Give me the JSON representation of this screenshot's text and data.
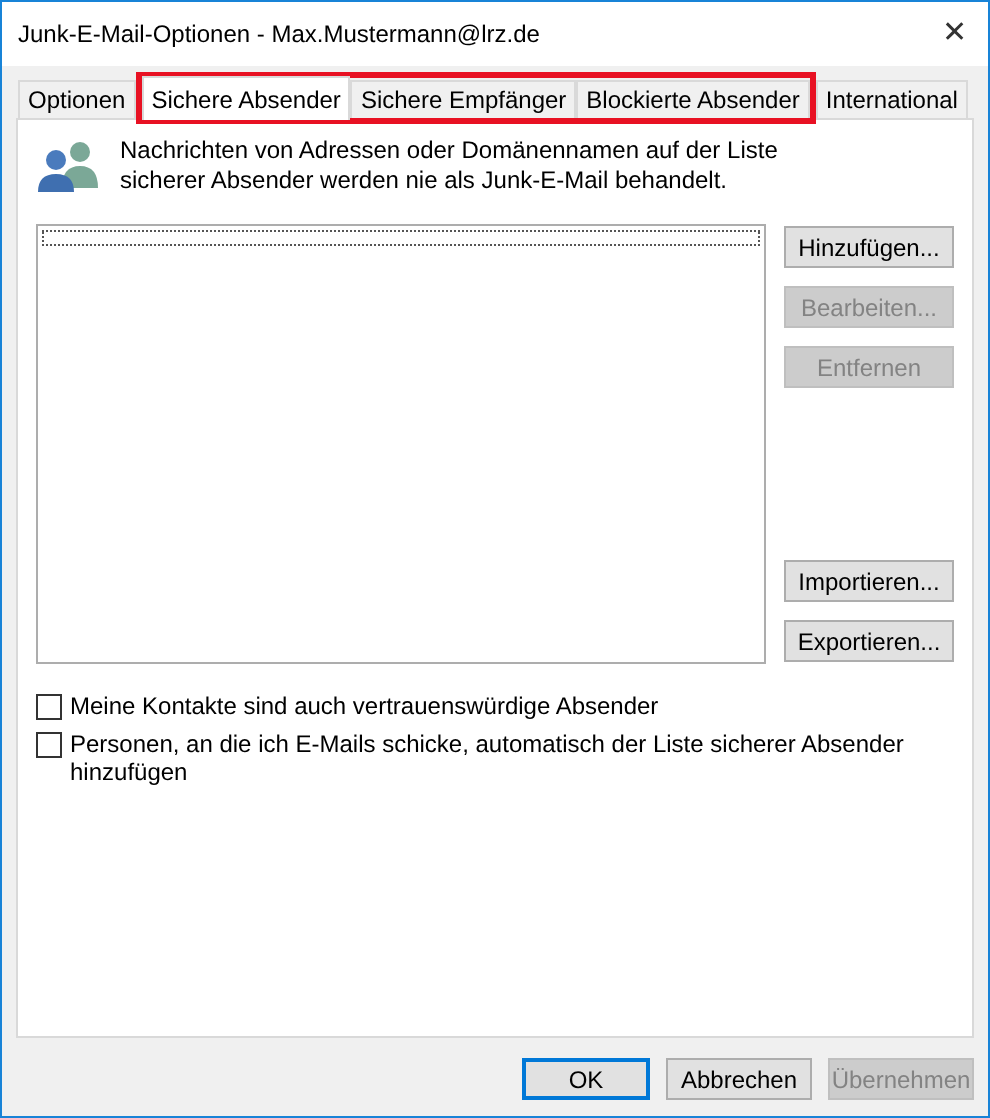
{
  "window": {
    "title": "Junk-E-Mail-Optionen - Max.Mustermann@lrz.de",
    "close": "✕"
  },
  "tabs": [
    {
      "label": "Optionen",
      "selected": false,
      "highlighted": false
    },
    {
      "label": "Sichere Absender",
      "selected": true,
      "highlighted": true
    },
    {
      "label": "Sichere Empfänger",
      "selected": false,
      "highlighted": true
    },
    {
      "label": "Blockierte Absender",
      "selected": false,
      "highlighted": true
    },
    {
      "label": "International",
      "selected": false,
      "highlighted": false
    }
  ],
  "description": "Nachrichten von Adressen oder Domänennamen auf der Liste sicherer Absender werden nie als Junk-E-Mail behandelt.",
  "side_buttons_top": [
    {
      "label": "Hinzufügen...",
      "disabled": false
    },
    {
      "label": "Bearbeiten...",
      "disabled": true
    },
    {
      "label": "Entfernen",
      "disabled": true
    }
  ],
  "side_buttons_bottom": [
    {
      "label": "Importieren...",
      "disabled": false
    },
    {
      "label": "Exportieren...",
      "disabled": false
    }
  ],
  "options": [
    {
      "label": "Meine Kontakte sind auch vertrauenswürdige Absender",
      "checked": false
    },
    {
      "label": "Personen, an die ich E-Mails schicke, automatisch der Liste sicherer Absender hinzufügen",
      "checked": false
    }
  ],
  "buttons": [
    {
      "label": "OK",
      "disabled": false,
      "default": true
    },
    {
      "label": "Abbrechen",
      "disabled": false,
      "default": false
    },
    {
      "label": "Übernehmen",
      "disabled": true,
      "default": false
    }
  ]
}
